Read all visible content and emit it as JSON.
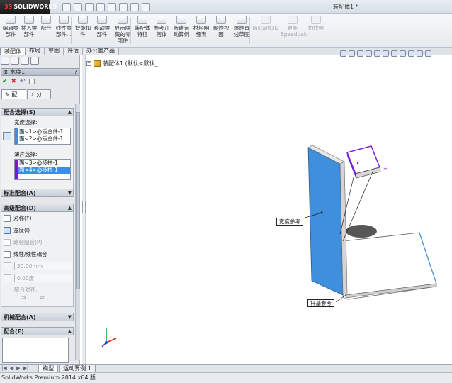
{
  "app": {
    "logo_text": "SOLIDWORKS",
    "logo_mark": "3S",
    "document_title": "装配体1 *"
  },
  "ribbon": {
    "buttons": [
      {
        "label": "编辑零\n部件",
        "icon": "edit-component-icon",
        "enabled": true
      },
      {
        "label": "插入零\n部件",
        "icon": "insert-component-icon",
        "enabled": true
      },
      {
        "label": "配合",
        "icon": "mate-icon",
        "enabled": true
      },
      {
        "label": "线性零\n部件...",
        "icon": "linear-pattern-icon",
        "enabled": true
      },
      {
        "label": "智能扣\n件",
        "icon": "smart-fastener-icon",
        "enabled": true
      },
      {
        "label": "移动零\n部件",
        "icon": "move-component-icon",
        "enabled": true
      },
      {
        "label": "显示隐\n藏的零\n部件",
        "icon": "show-hidden-icon",
        "enabled": true
      },
      {
        "label": "装配体\n特征",
        "icon": "assembly-feature-icon",
        "enabled": true
      },
      {
        "label": "参考几\n何体",
        "icon": "reference-geometry-icon",
        "enabled": true
      },
      {
        "label": "新建运\n动算例",
        "icon": "motion-study-icon",
        "enabled": true
      },
      {
        "label": "材料明\n细表",
        "icon": "bom-icon",
        "enabled": true
      },
      {
        "label": "爆炸视\n图",
        "icon": "exploded-view-icon",
        "enabled": true
      },
      {
        "label": "爆炸直\n线草图",
        "icon": "explode-line-icon",
        "enabled": true
      },
      {
        "label": "Instant3D",
        "icon": "instant3d-icon",
        "enabled": false
      },
      {
        "label": "更新\nSpeedpak",
        "icon": "speedpak-icon",
        "enabled": false
      },
      {
        "label": "拍快照",
        "icon": "snapshot-icon",
        "enabled": false
      }
    ]
  },
  "command_tabs": [
    {
      "label": "装配体",
      "active": true
    },
    {
      "label": "布局",
      "active": false
    },
    {
      "label": "草图",
      "active": false
    },
    {
      "label": "评估",
      "active": false
    },
    {
      "label": "办公室产品",
      "active": false
    }
  ],
  "property_manager": {
    "title": "宽度1",
    "help": "?",
    "subtabs": [
      {
        "label": "配...",
        "active": true
      },
      {
        "label": "分...",
        "active": false
      }
    ],
    "mate_selection": {
      "header": "配合选择(S)",
      "width_label": "宽度选择:",
      "width_items": [
        "面<1>@钣金件-1",
        "面<2>@钣金件-1"
      ],
      "tab_label": "薄片选择:",
      "tab_items": [
        "面<3>@棱柱-1",
        "面<4>@棱柱-1"
      ]
    },
    "standard_mates": {
      "header": "标准配合(A)"
    },
    "advanced_mates": {
      "header": "高级配合(D)",
      "options": [
        {
          "label": "对称(Y)",
          "enabled": true
        },
        {
          "label": "宽度(I)",
          "enabled": true
        },
        {
          "label": "路径配合(P)",
          "enabled": false
        },
        {
          "label": "线性/线性耦合",
          "enabled": true
        }
      ],
      "distance_value": "50.00mm",
      "angle_value": "0.00度",
      "mate_align_label": "配合对齐:"
    },
    "mechanical_mates": {
      "header": "机械配合(A)"
    },
    "mates": {
      "header": "配合(E)"
    }
  },
  "viewport": {
    "tree_root": "装配体1  (默认<默认_...",
    "callout_width_ref": "宽度参考",
    "callout_tab_ref": "杆基参考",
    "colors": {
      "face_highlight": "#3f8fdc",
      "selection": "#7a16d6"
    }
  },
  "bottom_tabs": [
    {
      "label": "模型",
      "active": true
    },
    {
      "label": "运动算例 1",
      "active": false
    }
  ],
  "status_bar": {
    "text": "SolidWorks Premium 2014 x64 版"
  }
}
